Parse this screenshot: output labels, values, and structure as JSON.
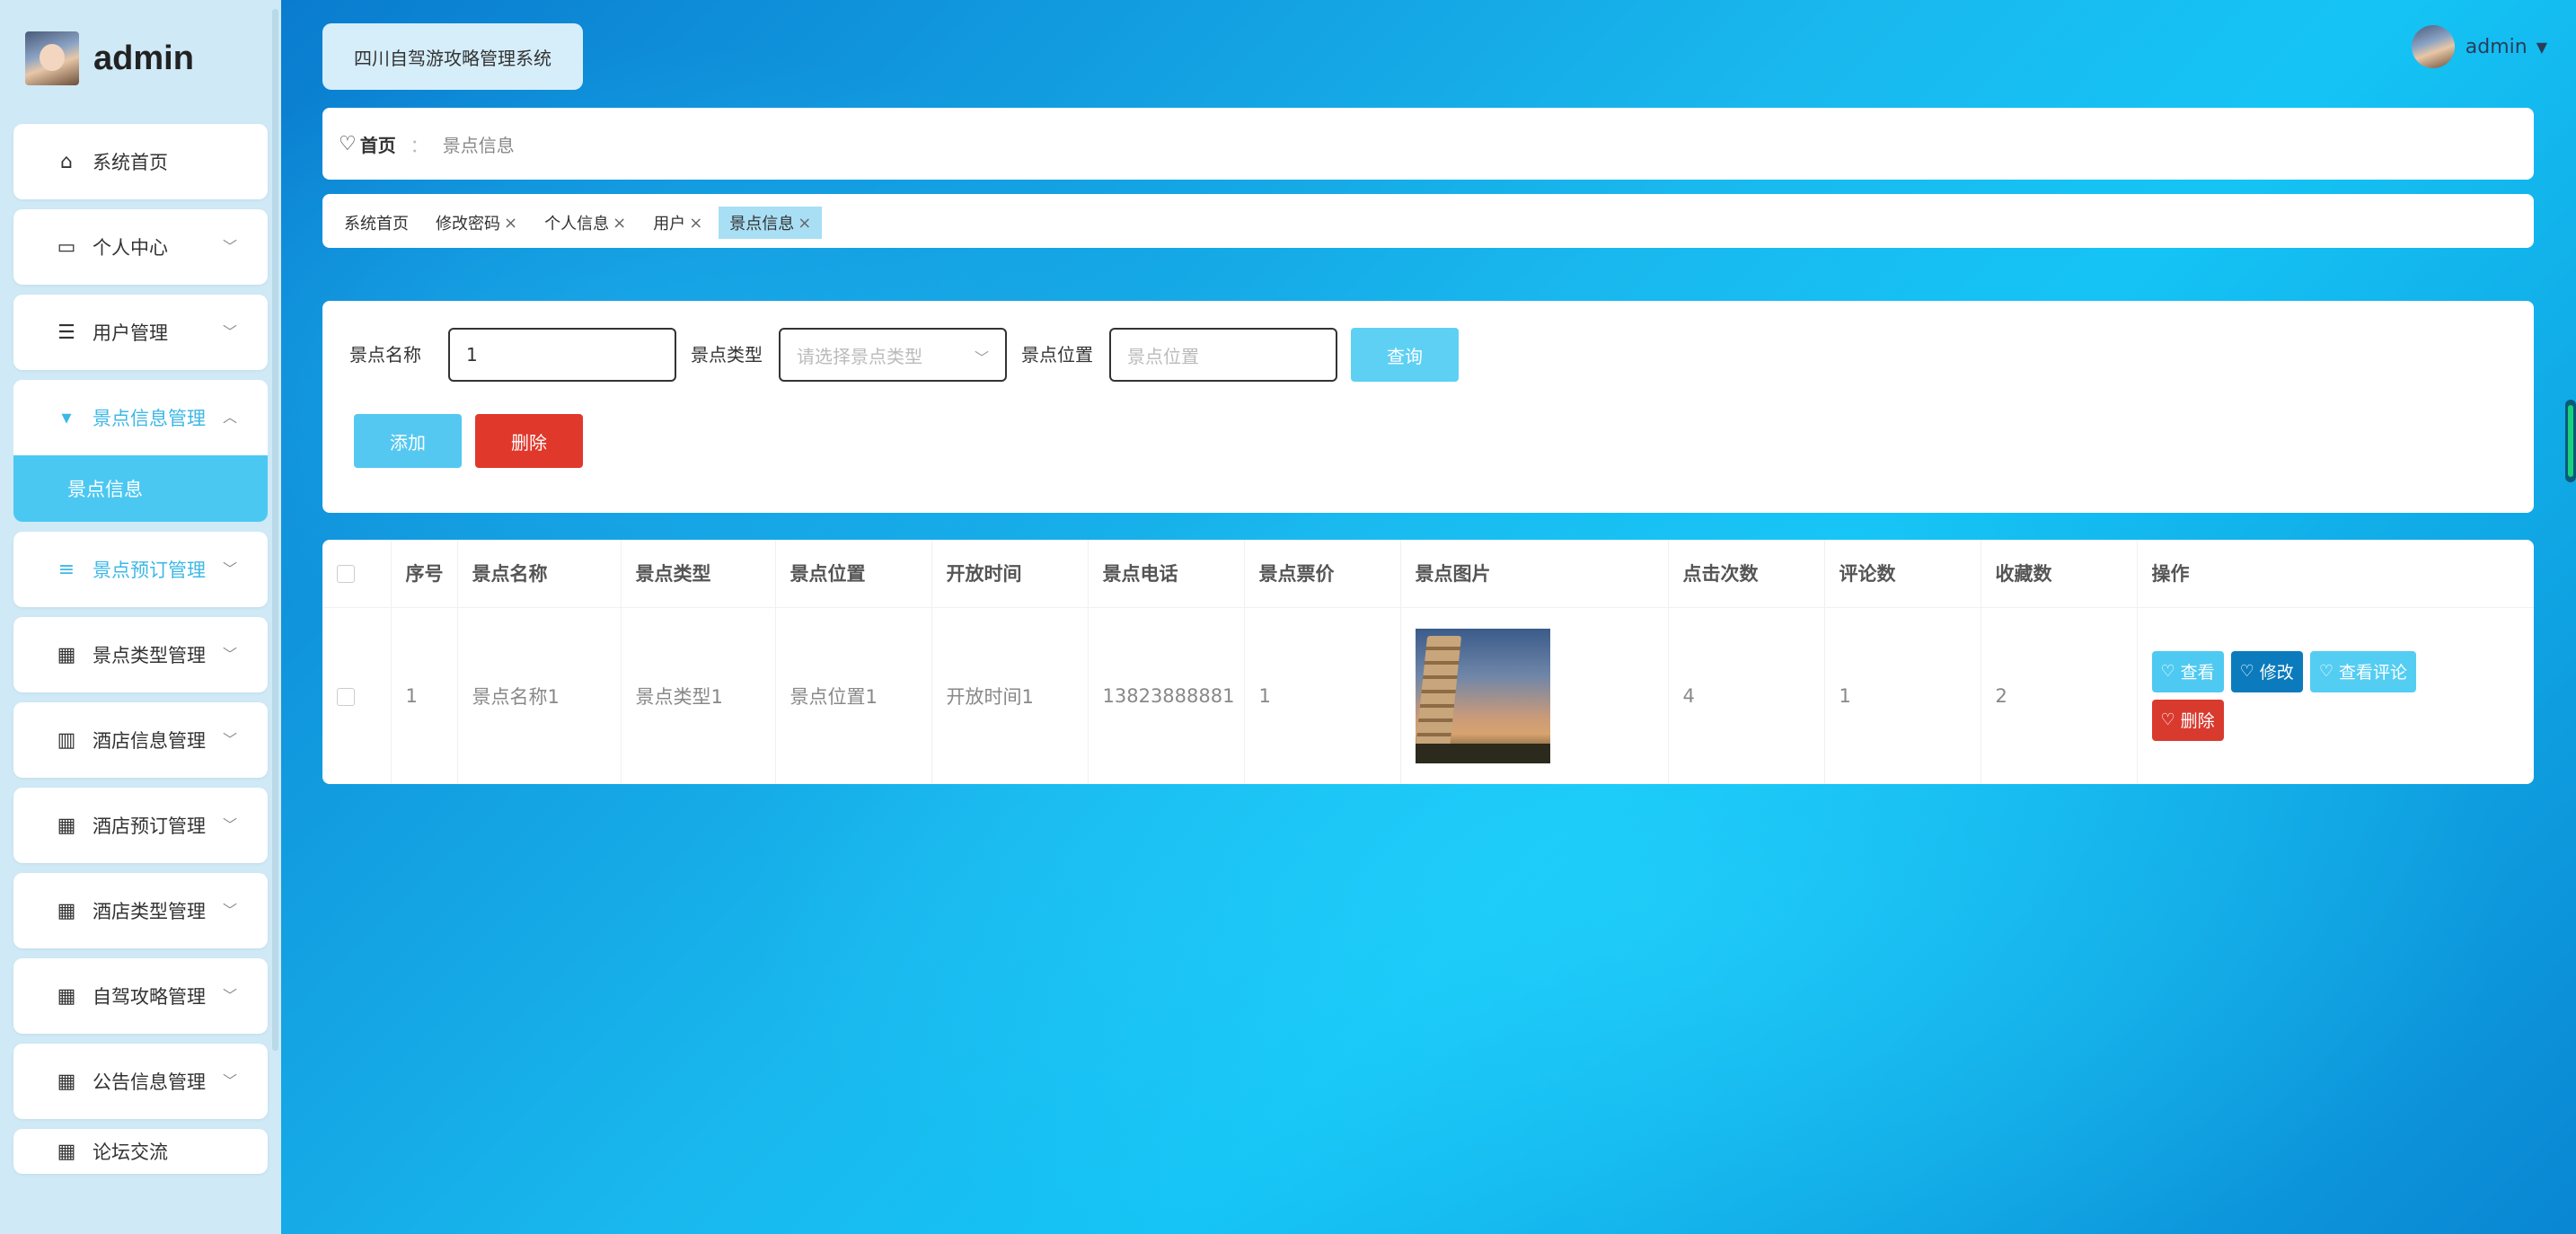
{
  "app": {
    "brand": "admin",
    "system_title": "四川自驾游攻略管理系统"
  },
  "user": {
    "name": "admin"
  },
  "sidebar": {
    "items": [
      {
        "label": "系统首页",
        "icon": "home-icon",
        "has_children": false
      },
      {
        "label": "个人中心",
        "icon": "card-icon",
        "has_children": true
      },
      {
        "label": "用户管理",
        "icon": "sliders-icon",
        "has_children": true
      },
      {
        "label": "景点信息管理",
        "icon": "pin-icon",
        "has_children": true,
        "expanded": true,
        "sub": [
          "景点信息"
        ]
      },
      {
        "label": "景点预订管理",
        "icon": "list-icon",
        "has_children": true
      },
      {
        "label": "景点类型管理",
        "icon": "grid-icon",
        "has_children": true
      },
      {
        "label": "酒店信息管理",
        "icon": "books-icon",
        "has_children": true
      },
      {
        "label": "酒店预订管理",
        "icon": "grid-icon",
        "has_children": true
      },
      {
        "label": "酒店类型管理",
        "icon": "grid-icon",
        "has_children": true
      },
      {
        "label": "自驾攻略管理",
        "icon": "grid-icon",
        "has_children": true
      },
      {
        "label": "公告信息管理",
        "icon": "grid-icon",
        "has_children": true
      },
      {
        "label": "论坛交流",
        "icon": "grid-icon",
        "has_children": true
      }
    ]
  },
  "breadcrumb": {
    "home": "首页",
    "separator": "：",
    "current": "景点信息"
  },
  "tabs": [
    {
      "label": "系统首页",
      "closable": false
    },
    {
      "label": "修改密码",
      "closable": true
    },
    {
      "label": "个人信息",
      "closable": true
    },
    {
      "label": "用户",
      "closable": true
    },
    {
      "label": "景点信息",
      "closable": true,
      "active": true
    }
  ],
  "search": {
    "name_label": "景点名称",
    "name_value": "1",
    "type_label": "景点类型",
    "type_placeholder": "请选择景点类型",
    "location_label": "景点位置",
    "location_placeholder": "景点位置",
    "query_button": "查询",
    "add_button": "添加",
    "delete_button": "删除"
  },
  "table": {
    "columns": [
      "序号",
      "景点名称",
      "景点类型",
      "景点位置",
      "开放时间",
      "景点电话",
      "景点票价",
      "景点图片",
      "点击次数",
      "评论数",
      "收藏数",
      "操作"
    ],
    "rows": [
      {
        "index": "1",
        "name": "景点名称1",
        "type": "景点类型1",
        "location": "景点位置1",
        "open_time": "开放时间1",
        "phone": "13823888881",
        "price": "1",
        "clicks": "4",
        "comments": "1",
        "favorites": "2"
      }
    ],
    "actions": {
      "view": "查看",
      "edit": "修改",
      "comments": "查看评论",
      "delete": "删除"
    }
  },
  "colors": {
    "accent": "#4bc8f2",
    "danger": "#e0382b",
    "edit": "#0b7bbd"
  }
}
